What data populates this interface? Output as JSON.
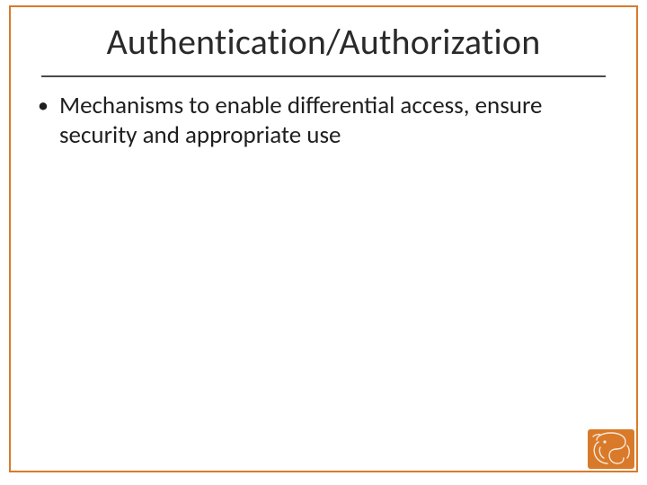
{
  "slide": {
    "title": "Authentication/Authorization",
    "bullets": [
      "Mechanisms to enable differential access, ensure security and appropriate use"
    ]
  },
  "colors": {
    "accent": "#d97a2a",
    "rule": "#4a4a4a"
  },
  "logo": {
    "name": "elephant-ornament-logo"
  }
}
